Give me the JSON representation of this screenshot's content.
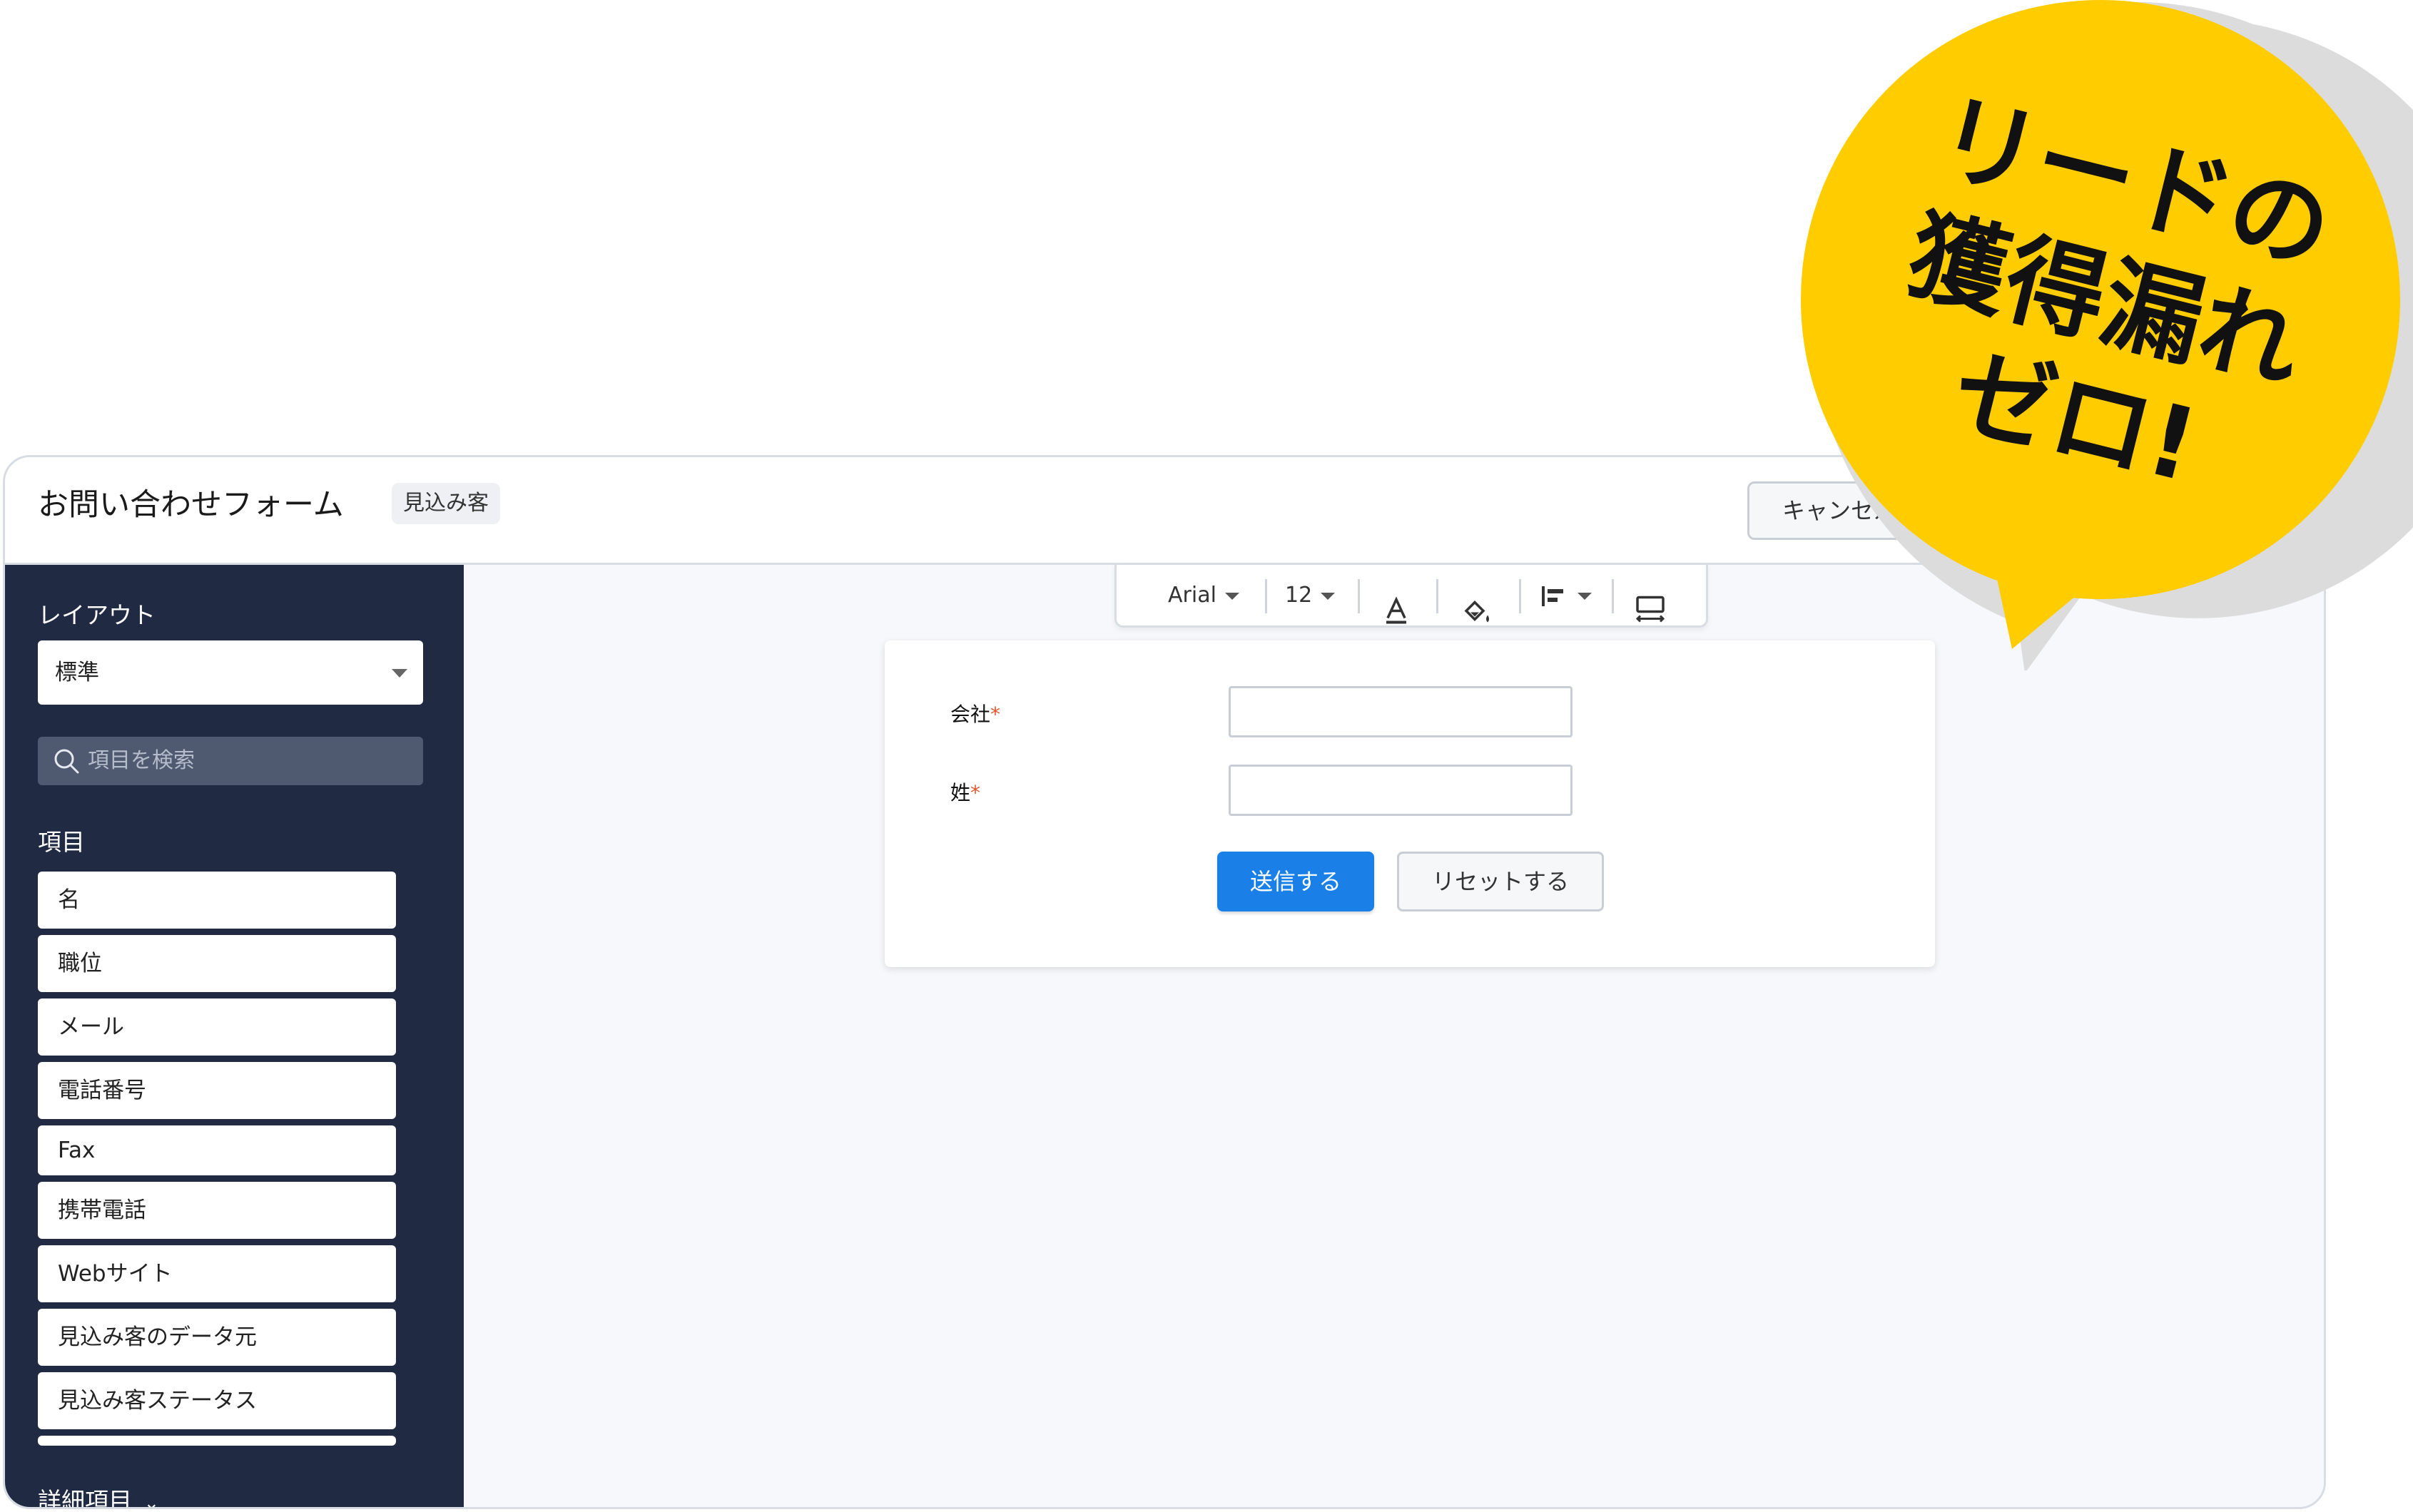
{
  "header": {
    "title": "お問い合わせフォーム",
    "object_tag": "見込み客",
    "cancel_label": "キャンセル"
  },
  "sidebar": {
    "layout_label": "レイアウト",
    "layout_value": "標準",
    "search_placeholder": "項目を検索",
    "fields_label": "項目",
    "fields": [
      "名",
      "職位",
      "メール",
      "電話番号",
      "Fax",
      "携帯電話",
      "Webサイト",
      "見込み客のデータ元",
      "見込み客ステータス"
    ],
    "advanced_label": "詳細項目"
  },
  "toolbar": {
    "font": "Arial",
    "size": "12",
    "icons": [
      "text-color-icon",
      "fill-color-icon",
      "align-icon",
      "width-icon"
    ]
  },
  "form": {
    "fields": [
      {
        "label": "会社",
        "required": "*"
      },
      {
        "label": "姓",
        "required": "*"
      }
    ],
    "submit_label": "送信する",
    "reset_label": "リセットする"
  },
  "callout": {
    "line1": "リードの",
    "line2": "獲得漏れ",
    "line3": "ゼロ!",
    "color": "#FFCC00"
  }
}
